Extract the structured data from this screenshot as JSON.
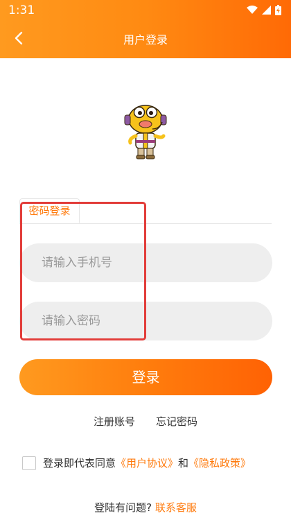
{
  "status_bar": {
    "time": "1:31"
  },
  "header": {
    "title": "用户登录"
  },
  "tabs": {
    "active_label": "密码登录"
  },
  "form": {
    "phone_placeholder": "请输入手机号",
    "password_placeholder": "请输入密码",
    "login_label": "登录"
  },
  "links": {
    "register": "注册账号",
    "forgot": "忘记密码"
  },
  "agreement": {
    "prefix": "登录即代表同意",
    "user_agreement": "《用户协议》",
    "and": "和",
    "privacy_policy": "《隐私政策》"
  },
  "help": {
    "question": "登陆有问题?",
    "contact": "联系客服"
  },
  "colors": {
    "accent": "#ff7a0c",
    "highlight": "#e23d3a"
  }
}
